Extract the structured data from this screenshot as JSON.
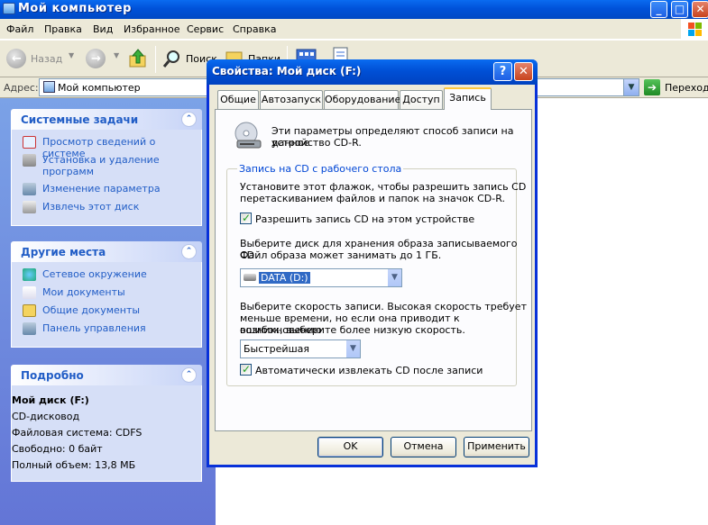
{
  "window": {
    "title": "Мой компьютер",
    "min": "_",
    "max": "□",
    "close": "✕"
  },
  "menu": [
    "Файл",
    "Правка",
    "Вид",
    "Избранное",
    "Сервис",
    "Справка"
  ],
  "toolbar": {
    "back": "Назад",
    "search": "Поиск",
    "folders": "Папки"
  },
  "address": {
    "label": "Адрес:",
    "value": "Мой компьютер",
    "go": "Переход"
  },
  "sidebar": {
    "system": {
      "title": "Системные задачи",
      "items": [
        "Просмотр сведений о системе",
        "Установка и удаление программ",
        "Изменение параметра",
        "Извлечь этот диск"
      ]
    },
    "places": {
      "title": "Другие места",
      "items": [
        "Сетевое окружение",
        "Мои документы",
        "Общие документы",
        "Панель управления"
      ]
    },
    "details": {
      "title": "Подробно",
      "name": "Мой диск (F:)",
      "type": "CD-дисковод",
      "fs": "Файловая система: CDFS",
      "free": "Свободно: 0 байт",
      "total": "Полный объем: 13,8 МБ"
    }
  },
  "dialog": {
    "title": "Свойства: Мой диск (F:)",
    "help": "?",
    "close": "✕",
    "tabs": [
      "Общие",
      "Автозапуск",
      "Оборудование",
      "Доступ",
      "Запись"
    ],
    "intro_line1": "Эти параметры определяют способ записи на данное",
    "intro_line2": "устройство CD-R.",
    "group_title": "Запись на CD с рабочего стола",
    "enable_text1": "Установите этот флажок, чтобы разрешить запись CD",
    "enable_text2": "перетаскиванием файлов и папок на значок CD-R.",
    "enable_checkbox": "Разрешить запись CD на этом устройстве",
    "image_text1": "Выберите диск для хранения образа записываемого CD.",
    "image_text2": "Файл образа может занимать до 1 ГБ.",
    "image_drive": "DATA (D:)",
    "speed_text1": "Выберите скорость записи. Высокая скорость требует",
    "speed_text2": "меньше времени, но если она приводит к возникновению",
    "speed_text3": "ошибок, выберите более низкую скорость.",
    "speed_value": "Быстрейшая",
    "eject_checkbox": "Автоматически извлекать CD после записи",
    "ok": "OK",
    "cancel": "Отмена",
    "apply": "Применить"
  }
}
